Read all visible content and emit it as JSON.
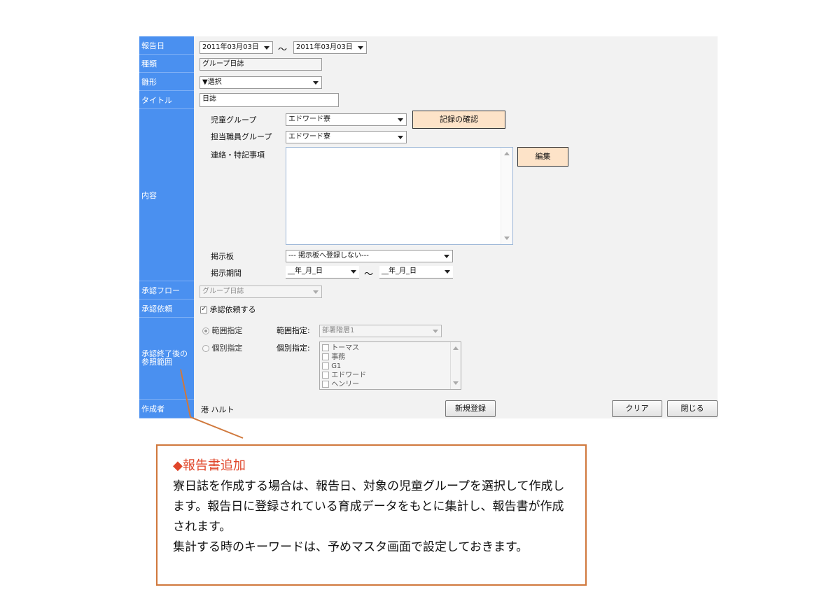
{
  "labels": {
    "report_date": "報告日",
    "type": "種類",
    "template": "雛形",
    "title": "タイトル",
    "content": "内容",
    "approval_flow": "承認フロー",
    "approval_request": "承認依頼",
    "ref_scope": "承認終了後の参照範囲",
    "author": "作成者"
  },
  "report_date": {
    "from": "2011年03月03日",
    "tilde": "～",
    "to": "2011年03月03日"
  },
  "type_value": "グループ日誌",
  "template_value": "▼選択",
  "title_value": "日誌",
  "content": {
    "child_group_label": "児童グループ",
    "child_group_value": "エドワード寮",
    "confirm_button": "記録の確認",
    "staff_group_label": "担当職員グループ",
    "staff_group_value": "エドワード寮",
    "notes_label": "連絡・特記事項",
    "notes_value": "",
    "edit_button": "編集",
    "board_label": "掲示板",
    "board_value": "--- 掲示板へ登録しない---",
    "period_label": "掲示期間",
    "period_from": "__年_月_日",
    "period_tilde": "～",
    "period_to": "__年_月_日"
  },
  "approval_flow_value": "グループ日誌",
  "approval_request": {
    "label": "承認依頼する",
    "checked": true
  },
  "ref_scope": {
    "range_radio": "範囲指定",
    "range_label": "範囲指定:",
    "range_value": "部署階層1",
    "individual_radio": "個別指定",
    "individual_label": "個別指定:",
    "individuals": [
      "トーマス",
      "事務",
      "G1",
      "エドワード",
      "ヘンリー"
    ]
  },
  "author_value": "港 ハルト",
  "buttons": {
    "new_register": "新規登録",
    "clear": "クリア",
    "close": "閉じる"
  },
  "callout": {
    "title": "◆報告書追加",
    "body_1": "寮日誌を作成する場合は、報告日、対象の児童グループを選択して作成します。報告日に登録されている育成データをもとに集計し、報告書が作成されます。",
    "body_2": "集計する時のキーワードは、予めマスタ画面で設定しておきます。"
  },
  "colors": {
    "label_bg": "#4a90f0",
    "form_bg": "#f2f2f2",
    "peach": "#fde3c8",
    "callout_border": "#d0783c",
    "callout_title": "#e0462a"
  }
}
